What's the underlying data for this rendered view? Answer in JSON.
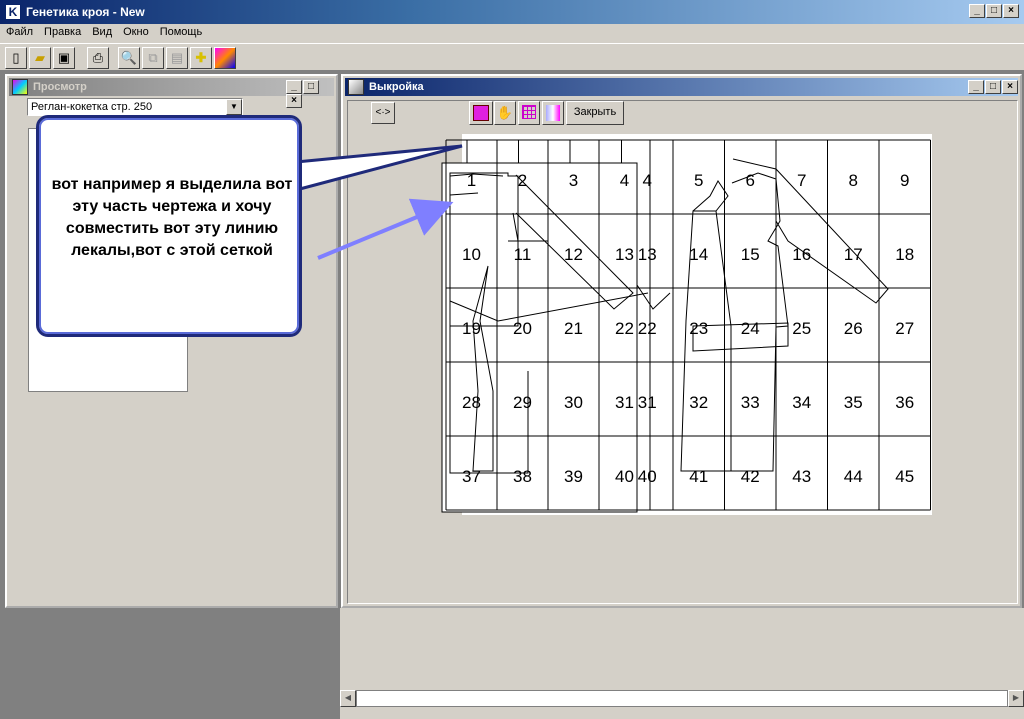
{
  "app": {
    "title": "Генетика кроя - New",
    "icon_letter": "K"
  },
  "menu": [
    "Файл",
    "Правка",
    "Вид",
    "Окно",
    "Помощь"
  ],
  "toolbar": [
    "new-icon",
    "open-icon",
    "save-icon",
    "print-icon",
    "preview-icon",
    "copy-icon",
    "paste-icon",
    "ruler-icon",
    "image-icon"
  ],
  "preview_window": {
    "title": "Просмотр",
    "combo_value": "Реглан-кокетка стр. 250"
  },
  "pattern_window": {
    "title": "Выкройка",
    "nav_label": "<·>",
    "close_label": "Закрыть"
  },
  "grid": {
    "rows": [
      [
        "1",
        "2",
        "3",
        "4",
        "5",
        "6",
        "7",
        "8",
        "9"
      ],
      [
        "10",
        "11",
        "12",
        "13",
        "14",
        "15",
        "16",
        "17",
        "18"
      ],
      [
        "19",
        "20",
        "21",
        "22",
        "23",
        "24",
        "25",
        "26",
        "27"
      ],
      [
        "28",
        "29",
        "30",
        "31",
        "32",
        "33",
        "34",
        "35",
        "36"
      ],
      [
        "37",
        "38",
        "39",
        "40",
        "41",
        "42",
        "43",
        "44",
        "45"
      ]
    ],
    "overlay_rows": [
      [
        "1",
        "2",
        "3",
        "4"
      ],
      [
        "10",
        "11",
        "12",
        "13"
      ],
      [
        "19",
        "20",
        "21",
        "22"
      ],
      [
        "28",
        "29",
        "30",
        "31"
      ],
      [
        "37",
        "38",
        "39",
        "40"
      ]
    ]
  },
  "callout": {
    "text": "вот например я выделила вот эту часть чертежа и хочу совместить вот эту линию лекалы,вот с этой сеткой"
  },
  "colors": {
    "title_active": "#0a246a",
    "arrow": "#7f7fff",
    "callout_border": "#1f2a7a"
  }
}
